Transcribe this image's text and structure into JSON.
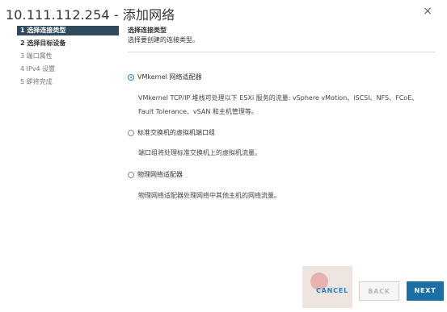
{
  "window": {
    "title": "10.111.112.254 - 添加网络",
    "close_glyph": "×"
  },
  "sidebar": {
    "steps": [
      {
        "label": "1 选择连接类型",
        "state": "active"
      },
      {
        "label": "2 选择目标设备",
        "state": "done"
      },
      {
        "label": "3 端口属性",
        "state": "pending"
      },
      {
        "label": "4 IPv4 设置",
        "state": "pending"
      },
      {
        "label": "5 即将完成",
        "state": "pending"
      }
    ]
  },
  "main": {
    "title": "选择连接类型",
    "subtitle": "选择要创建的连接类型。",
    "options": [
      {
        "label": "VMkernel 网络适配器",
        "selected": true,
        "description_lines": [
          "VMkernel TCP/IP 堆栈可处理以下 ESXi 服务的流量: vSphere vMotion、iSCSI、NFS、FCoE、",
          "Fault Tolerance、vSAN 和主机管理等。"
        ]
      },
      {
        "label": "标准交换机的虚拟机端口组",
        "selected": false,
        "description_lines": [
          "端口组将处理标准交换机上的虚拟机流量。"
        ]
      },
      {
        "label": "物理网络适配器",
        "selected": false,
        "description_lines": [
          "物理网络适配器处理网络中其他主机的网络流量。"
        ]
      }
    ]
  },
  "footer": {
    "cancel_label": "CANCEL",
    "back_label": "BACK",
    "next_label": "NEXT"
  },
  "colors": {
    "accent": "#1c82c6",
    "sidebar_active_bg": "#2f4a5c",
    "primary_button": "#1c6fa6"
  },
  "icons": {
    "close": "close-icon",
    "radio_selected": "radio-selected-icon",
    "radio_unselected": "radio-unselected-icon"
  }
}
